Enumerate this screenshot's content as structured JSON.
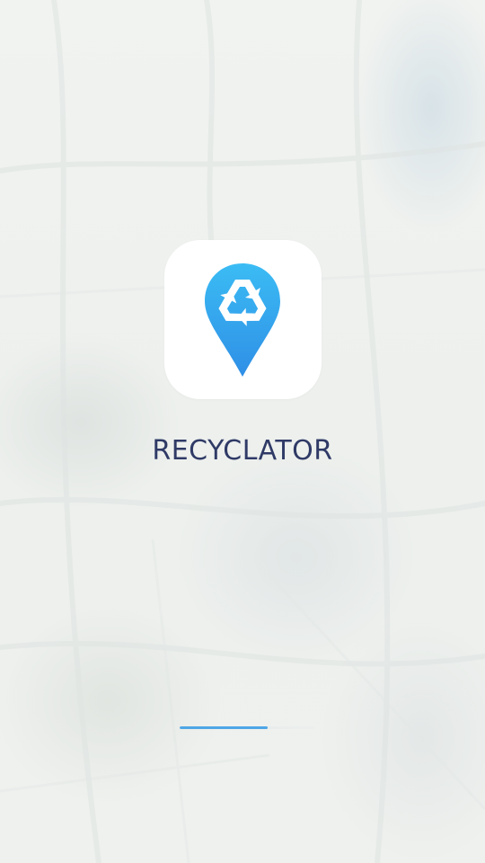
{
  "app": {
    "name": "RECYCLATOR",
    "logo_icon": "recycle-map-pin-icon"
  },
  "loading": {
    "progress_fraction": 0.65
  },
  "colors": {
    "brand_blue": "#3aa9ee",
    "title_text": "#2f3a66",
    "progress_fill": "#4fa6e6",
    "background": "#eef1ee"
  }
}
